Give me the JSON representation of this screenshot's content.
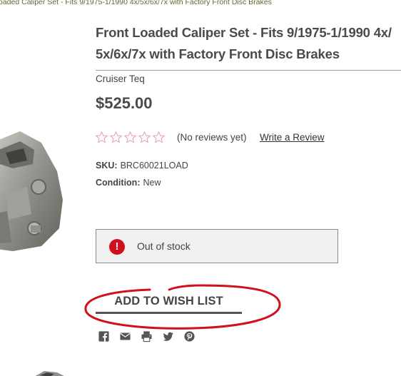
{
  "breadcrumb": "oaded Caliper Set - Fits 9/1975-1/1990 4x/5x/6x/7x with Factory Front Disc Brakes",
  "product": {
    "title": "Front Loaded Caliper Set - Fits 9/1975-1/1990 4x/ 5x/6x/7x with Factory Front Disc Brakes",
    "brand": "Cruiser Teq",
    "price": "$525.00",
    "reviews_text": "(No reviews yet)",
    "write_review": "Write a Review",
    "rating_stars_filled": 0,
    "rating_stars_total": 5,
    "sku_label": "SKU:",
    "sku_value": "BRC60021LOAD",
    "condition_label": "Condition:",
    "condition_value": "New"
  },
  "stock": {
    "icon": "!",
    "text": "Out of stock"
  },
  "wishlist": {
    "label": "ADD TO WISH LIST"
  },
  "share_icons": [
    "facebook-icon",
    "email-icon",
    "print-icon",
    "twitter-icon",
    "pinterest-icon"
  ],
  "colors": {
    "accent_red": "#d0111b",
    "annotation_red": "#d0111b",
    "breadcrumb_green": "#5d6a33",
    "star_outline": "#e8a0a8"
  }
}
